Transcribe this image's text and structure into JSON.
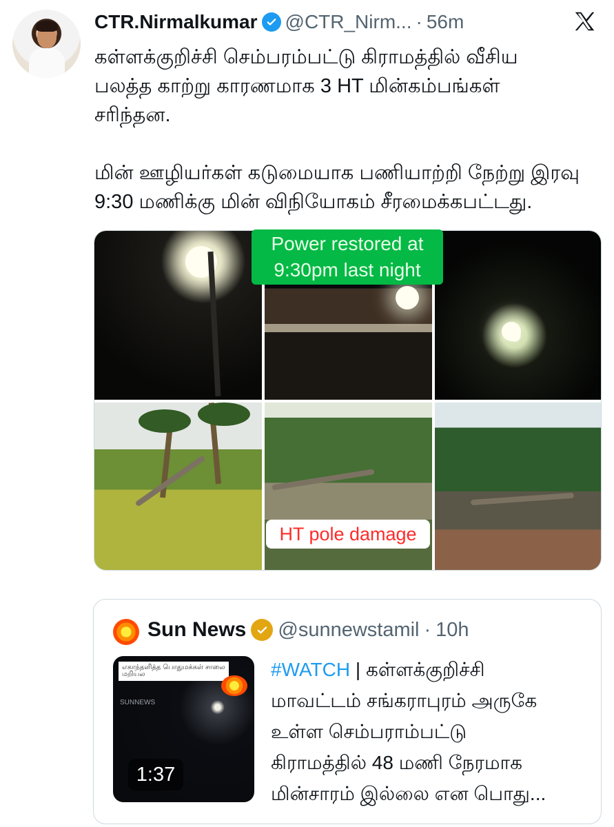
{
  "tweet": {
    "display_name": "CTR.Nirmalkumar",
    "handle": "@CTR_Nirm...",
    "separator": "·",
    "time": "56m",
    "text_lines": [
      "கள்ளக்குறிச்சி செம்பரம்பட்டு கிராமத்தில் வீசிய",
      "பலத்த காற்று காரணமாக 3 HT  மின்கம்பங்கள்",
      "சரிந்தன.",
      "மின் ஊழியர்கள் கடுமையாக பணியாற்றி நேற்று இரவு",
      "9:30 மணிக்கு மின் விநியோகம் சீரமைக்கபட்டது."
    ]
  },
  "media": {
    "overlay_top": [
      "Power restored at",
      "9:30pm last night"
    ],
    "overlay_bottom": "HT pole damage"
  },
  "quote": {
    "display_name": "Sun News",
    "handle": "@sunnewstamil",
    "separator": "·",
    "time": "10h",
    "hashtag": "#WATCH",
    "text_after_hash": " | கள்ளக்குறிச்சி",
    "text_lines": [
      "மாவட்டம் சங்கராபுரம் அருகே",
      "உள்ள செம்பராம்பட்டு",
      "கிராமத்தில் 48 மணி நேரமாக",
      "மின்சாரம் இல்லை என பொது..."
    ],
    "video_duration": "1:37",
    "thumbnail_banner": "எகாந்தளித்த பொதுமக்கள் சாலை மறியல",
    "thumbnail_watermark": "SUNNEWS"
  },
  "colors": {
    "verified_blue": "#1d9bf0",
    "gold_badge": "#e2a613",
    "overlay_green": "#04b945",
    "overlay_red_text": "#ff2b2b"
  },
  "icons": [
    "verified-icon",
    "x-logo-icon",
    "gold-verified-icon",
    "sun-news-logo-icon"
  ]
}
